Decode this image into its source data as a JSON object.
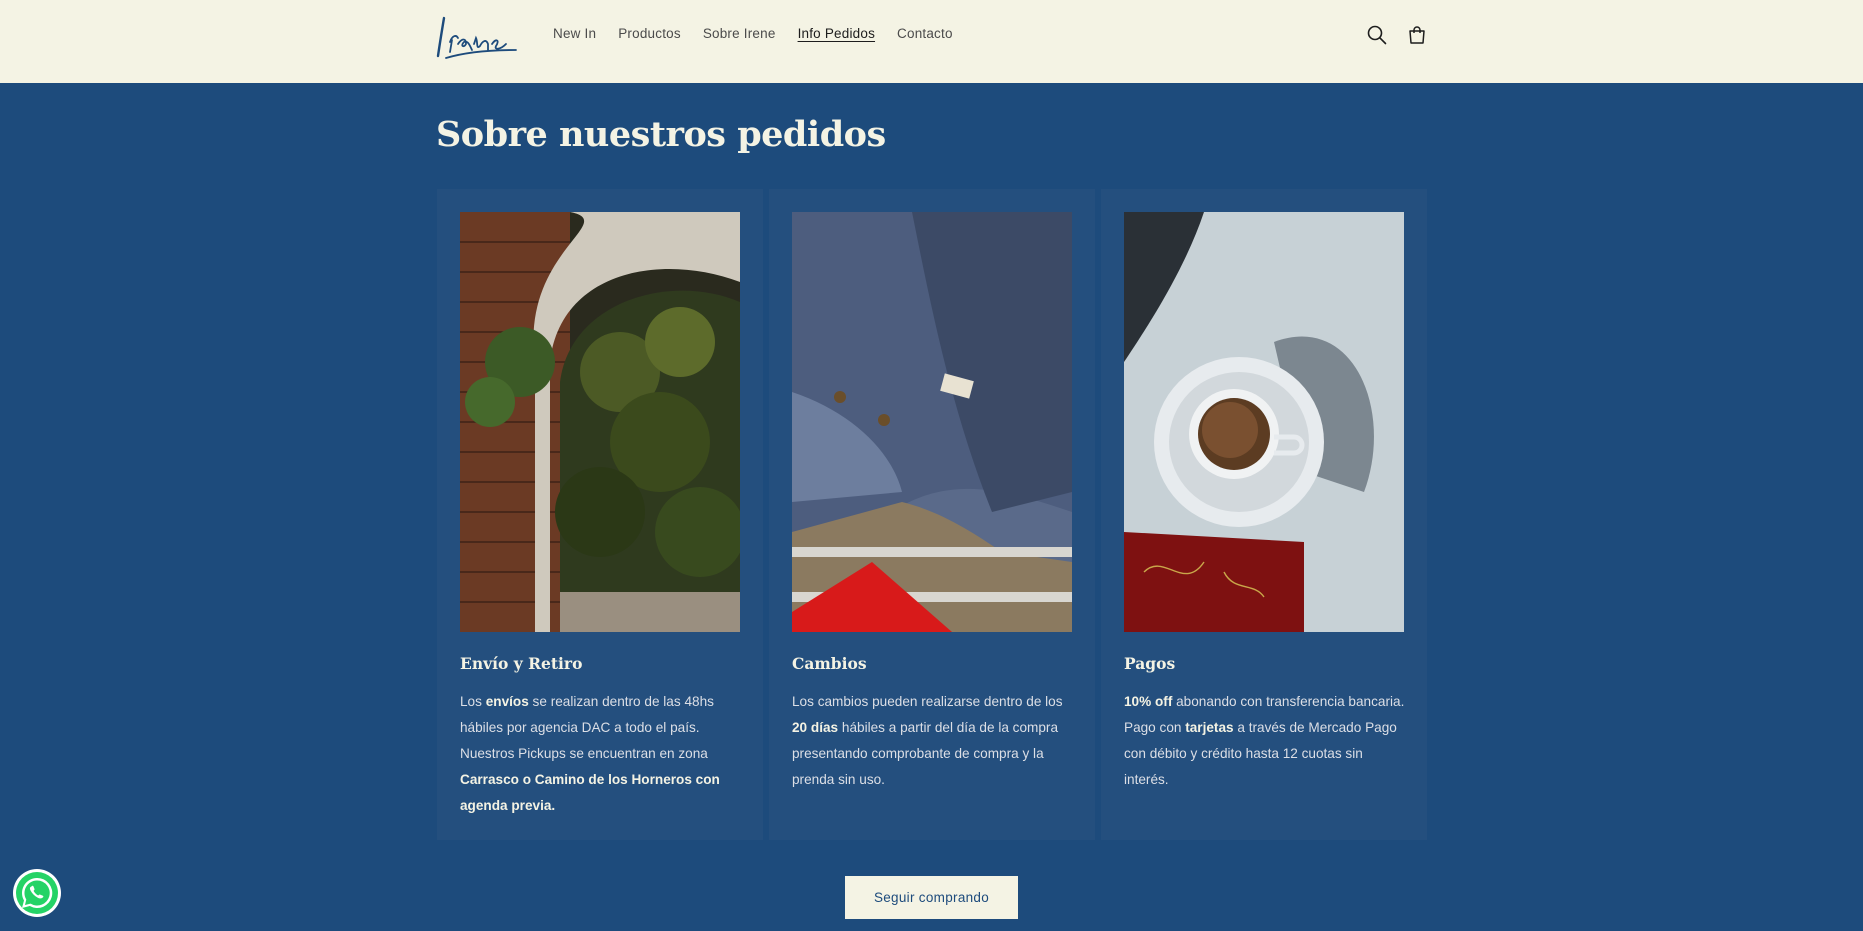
{
  "header": {
    "logo_text": "Irene",
    "nav": [
      {
        "label": "New In"
      },
      {
        "label": "Productos"
      },
      {
        "label": "Sobre Irene"
      },
      {
        "label": "Info Pedidos",
        "active": true
      },
      {
        "label": "Contacto"
      }
    ],
    "icons": [
      "search-icon",
      "cart-icon"
    ]
  },
  "main": {
    "title": "Sobre nuestros pedidos",
    "cards": [
      {
        "title": "Envío y Retiro",
        "image": "brick-arch-garden-photo",
        "p1_a": "Los ",
        "p1_b": "envíos",
        "p1_c": " se realizan dentro de las 48hs hábiles por agencia DAC a todo el país.",
        "p2_a": "Nuestros Pickups se encuentran en zona ",
        "p2_b": "Carrasco o Camino de los Horneros con agenda previa."
      },
      {
        "title": "Cambios",
        "image": "blue-knit-cardigan-photo",
        "p1_a": "Los cambios pueden realizarse dentro de los ",
        "p1_b": "20 días",
        "p1_c": " hábiles a partir del día de la compra presentando comprobante de compra y la prenda sin uso."
      },
      {
        "title": "Pagos",
        "image": "coffee-cup-photo",
        "p1_a": "10% off",
        "p1_b": " abonando con transferencia bancaria.",
        "p2_a": "Pago con ",
        "p2_b": "tarjetas",
        "p2_c": " a través de Mercado Pago con débito y crédito hasta 12 cuotas sin interés."
      }
    ],
    "button_label": "Seguir comprando"
  },
  "widgets": {
    "whatsapp": "whatsapp-icon"
  },
  "colors": {
    "background": "#1d4b7c",
    "card": "#244f7e",
    "header": "#f4f3e4",
    "text_light": "#f4f3e4"
  }
}
